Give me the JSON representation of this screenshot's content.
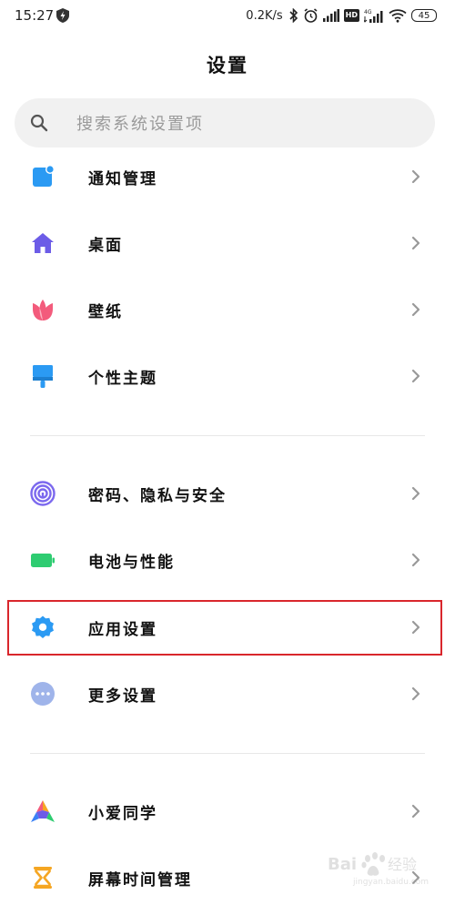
{
  "status_bar": {
    "time": "15:27",
    "net_speed": "0.2K/s",
    "battery_level": "45"
  },
  "page": {
    "title": "设置"
  },
  "search": {
    "placeholder": "搜索系统设置项"
  },
  "groups": [
    {
      "items": [
        {
          "label": "通知管理",
          "icon": "notification-icon",
          "color": "#2b9af3"
        },
        {
          "label": "桌面",
          "icon": "home-icon",
          "color": "#6c5ce7"
        },
        {
          "label": "壁纸",
          "icon": "tulip-icon",
          "color": "#f35b7c"
        },
        {
          "label": "个性主题",
          "icon": "paint-brush-icon",
          "color": "#2b9af3"
        }
      ]
    },
    {
      "items": [
        {
          "label": "密码、隐私与安全",
          "icon": "fingerprint-icon",
          "color": "#7b68ee"
        },
        {
          "label": "电池与性能",
          "icon": "battery-icon",
          "color": "#2ecc71"
        },
        {
          "label": "应用设置",
          "icon": "gear-icon",
          "color": "#2b9af3",
          "highlighted": true
        },
        {
          "label": "更多设置",
          "icon": "more-dots-icon",
          "color": "#9fb4ea"
        }
      ]
    },
    {
      "items": [
        {
          "label": "小爱同学",
          "icon": "xiaoai-icon",
          "color": "#3b82f6"
        },
        {
          "label": "屏幕时间管理",
          "icon": "hourglass-icon",
          "color": "#f5a623"
        }
      ]
    }
  ],
  "colors": {
    "highlight": "#d9262c",
    "search_bg": "#f1f1f1"
  }
}
